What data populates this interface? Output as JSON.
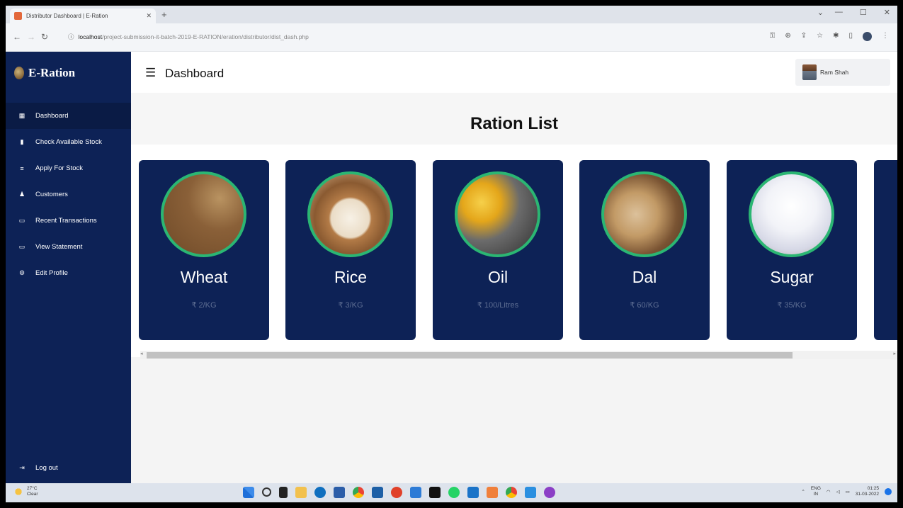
{
  "browser": {
    "tab_title": "Distributor Dashboard | E-Ration",
    "url_host": "localhost",
    "url_path": "/project-submission-it-batch-2019-E-RATION/eration/distributor/dist_dash.php"
  },
  "sidebar": {
    "brand": "E-Ration",
    "items": [
      {
        "label": "Dashboard",
        "icon": "dashboard-icon"
      },
      {
        "label": "Check Available Stock",
        "icon": "stock-icon"
      },
      {
        "label": "Apply For Stock",
        "icon": "list-icon"
      },
      {
        "label": "Customers",
        "icon": "person-icon"
      },
      {
        "label": "Recent Transactions",
        "icon": "monitor-icon"
      },
      {
        "label": "View Statement",
        "icon": "monitor-icon"
      },
      {
        "label": "Edit Profile",
        "icon": "gear-icon"
      }
    ],
    "logout": "Log out"
  },
  "header": {
    "title": "Dashboard",
    "user_name": "Ram Shah"
  },
  "main": {
    "title": "Ration List",
    "items": [
      {
        "name": "Wheat",
        "price": "₹ 2/KG"
      },
      {
        "name": "Rice",
        "price": "₹ 3/KG"
      },
      {
        "name": "Oil",
        "price": "₹ 100/Litres"
      },
      {
        "name": "Dal",
        "price": "₹ 60/KG"
      },
      {
        "name": "Sugar",
        "price": "₹ 35/KG"
      }
    ]
  },
  "taskbar": {
    "temperature": "27°C",
    "weather": "Clear",
    "lang": "ENG",
    "region": "IN",
    "time": "01:25",
    "date": "31-03-2022"
  },
  "colors": {
    "sidebar": "#0d2256",
    "card": "#0d2256",
    "card_ring": "#2bb673",
    "price_text": "#5f6f93"
  }
}
